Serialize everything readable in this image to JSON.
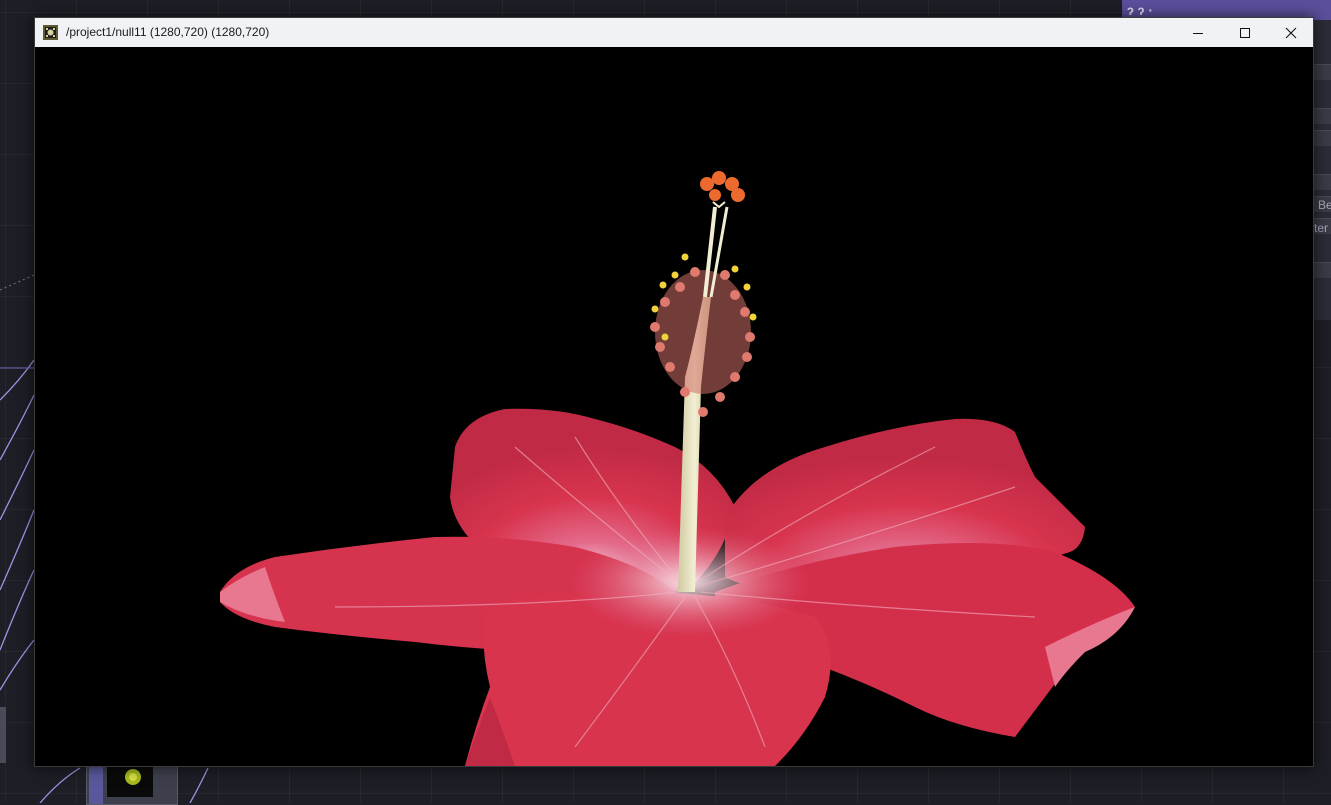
{
  "window": {
    "title": "/project1/null11 (1280,720) (1280,720)",
    "app_icon": "touchdesigner-icon",
    "buttons": {
      "minimize": "minimize-icon",
      "maximize": "maximize-icon",
      "close": "close-icon"
    }
  },
  "viewer": {
    "content": "hibiscus-flower-image",
    "background_color": "#000000",
    "petal_color": "#d8344e",
    "stamen_color": "#e8e0b8"
  },
  "background": {
    "editor_color": "#1d1e26",
    "panel_header_color": "#5b4f9c",
    "panel_header_text": "ɂ ɂ ·",
    "panel_texts": [
      "Be",
      "ter"
    ]
  }
}
